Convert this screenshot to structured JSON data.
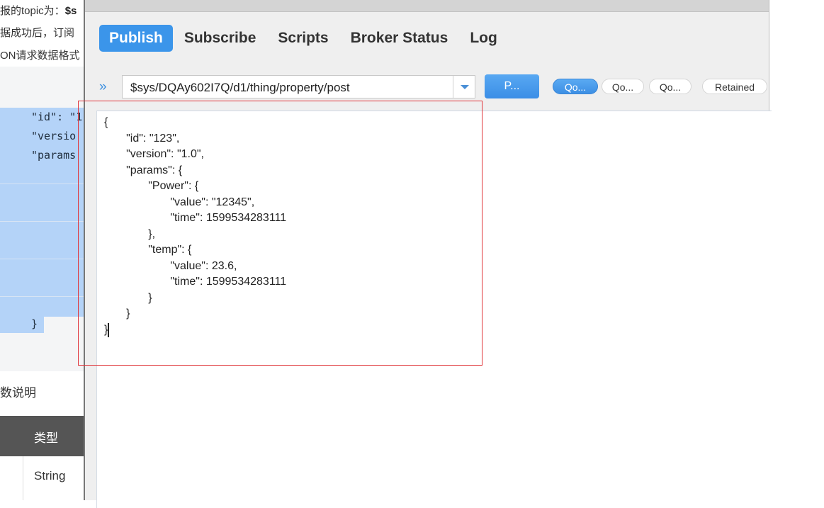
{
  "doc": {
    "line1_prefix": "报的topic为：",
    "line1_bold": "$s",
    "line2": "据成功后，订阅",
    "line3": "ON请求数据格式",
    "code_lines": [
      "\"id\": \"1",
      "\"versio",
      "\"params",
      "}"
    ],
    "params_title": "数说明",
    "table_header": "类型",
    "table_cell": "String"
  },
  "app": {
    "tabs": [
      {
        "label": "Publish",
        "active": true
      },
      {
        "label": "Subscribe"
      },
      {
        "label": "Scripts"
      },
      {
        "label": "Broker Status"
      },
      {
        "label": "Log"
      }
    ],
    "topic": "$sys/DQAy602I7Q/d1/thing/property/post",
    "publish_label": "P...",
    "qos_labels": [
      "Qo...",
      "Qo...",
      "Qo..."
    ],
    "retained_label": "Retained",
    "payload": "{\n       \"id\": \"123\",\n       \"version\": \"1.0\",\n       \"params\": {\n              \"Power\": {\n                     \"value\": \"12345\",\n                     \"time\": 1599534283111\n              },\n              \"temp\": {\n                     \"value\": 23.6,\n                     \"time\": 1599534283111\n              }\n       }\n}",
    "accent_color": "#3b95ea",
    "highlight_color": "#e0353a"
  }
}
